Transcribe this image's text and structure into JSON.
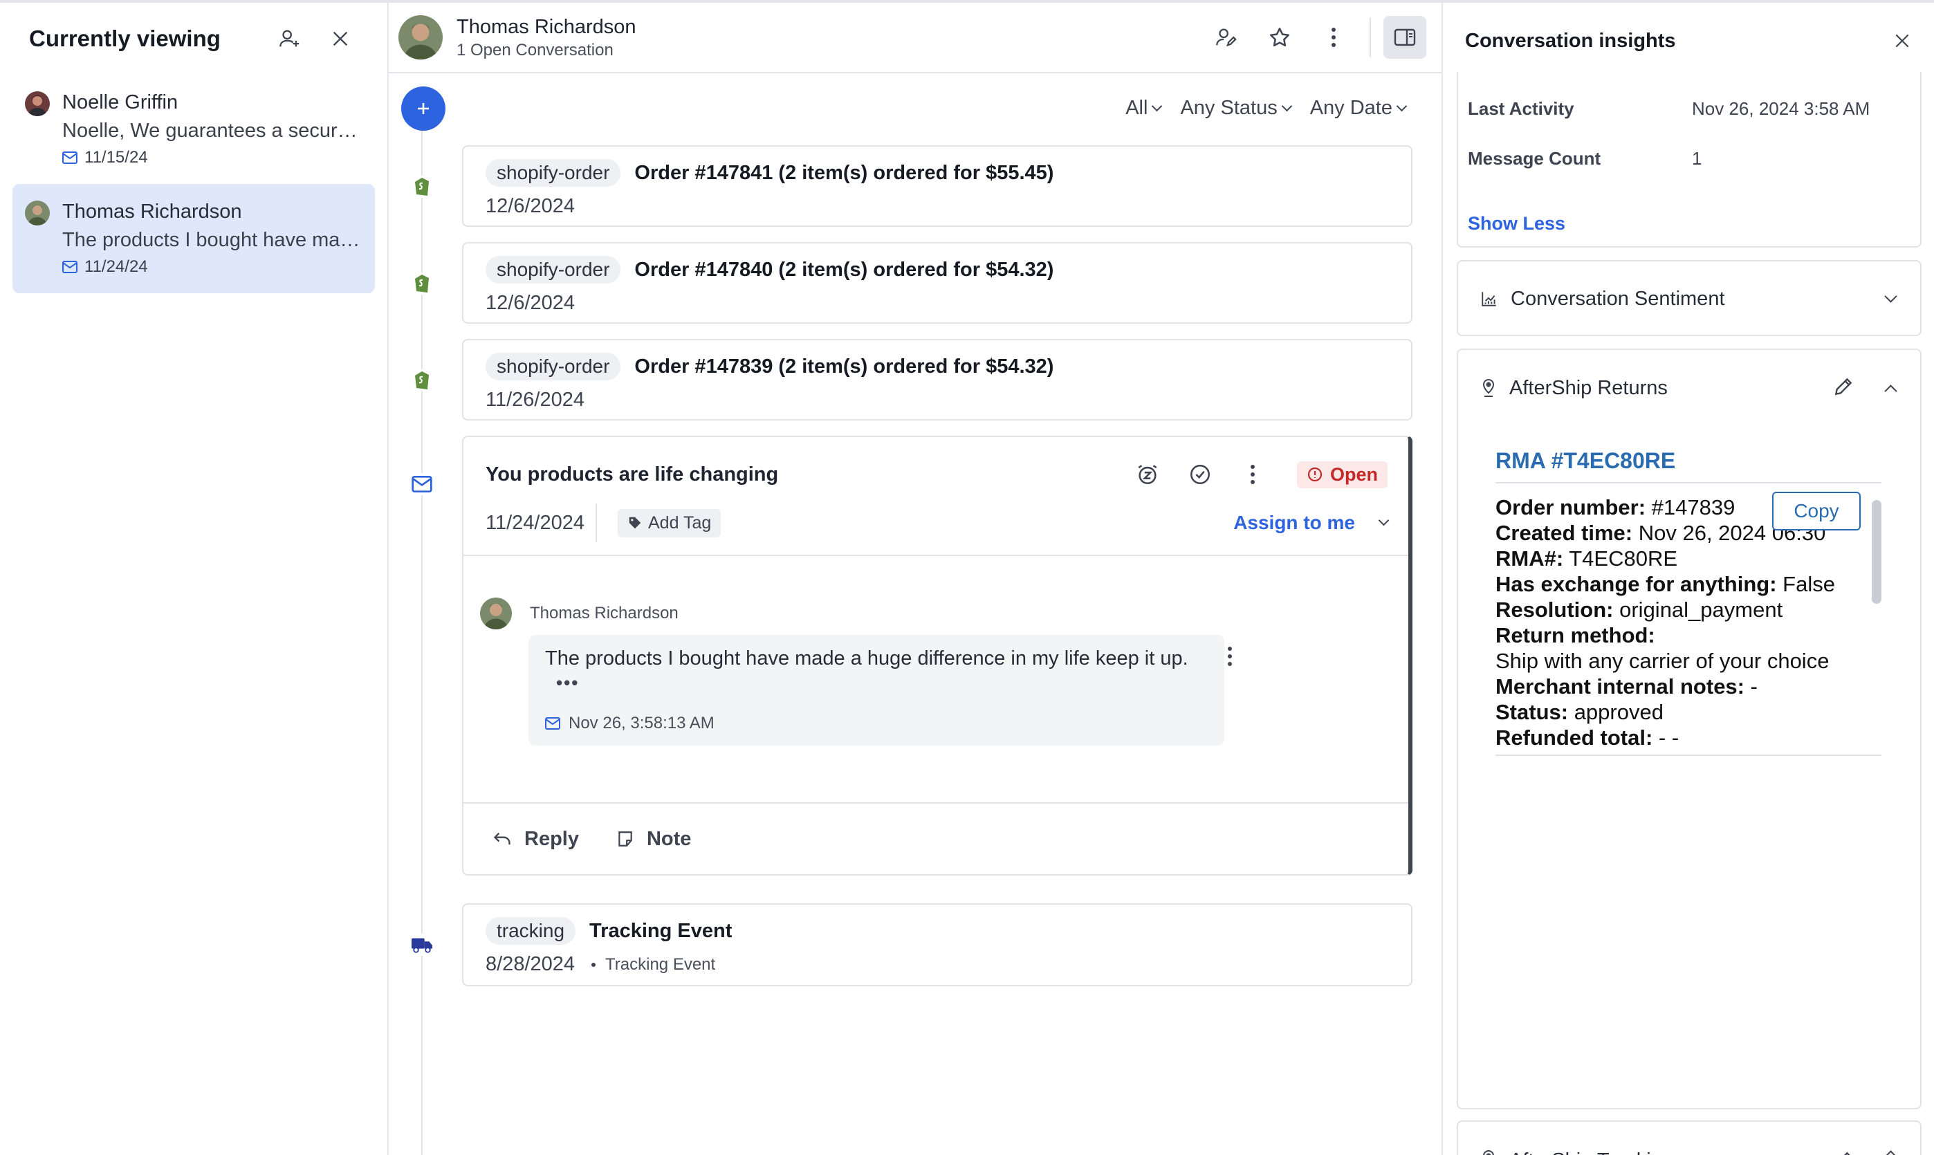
{
  "left_panel": {
    "title": "Currently viewing",
    "conversations": [
      {
        "name": "Noelle Griffin",
        "preview": "Noelle, We guarantees a secure payment process and all transactions are encrypted.",
        "date": "11/15/24",
        "active": false
      },
      {
        "name": "Thomas Richardson",
        "preview": "The products I bought have made a huge difference in my life keep it up.",
        "date": "11/24/24",
        "active": true
      }
    ]
  },
  "header": {
    "customer_name": "Thomas Richardson",
    "subtitle": "1 Open Conversation"
  },
  "filters": {
    "channel": "All",
    "status": "Any Status",
    "date": "Any Date"
  },
  "orders": [
    {
      "pill": "shopify-order",
      "title": "Order #147841 (2 item(s) ordered for $55.45)",
      "date": "12/6/2024"
    },
    {
      "pill": "shopify-order",
      "title": "Order #147840 (2 item(s) ordered for $54.32)",
      "date": "12/6/2024"
    },
    {
      "pill": "shopify-order",
      "title": "Order #147839 (2 item(s) ordered for $54.32)",
      "date": "11/26/2024"
    }
  ],
  "conversation": {
    "subject": "You products are life changing",
    "status": "Open",
    "date": "11/24/2024",
    "add_tag": "Add Tag",
    "assign": "Assign to me",
    "message": {
      "author": "Thomas Richardson",
      "text": "The products I bought have made a huge difference in my life keep it up.",
      "expand": "•••",
      "time": "Nov 26, 3:58:13 AM"
    },
    "reply_label": "Reply",
    "note_label": "Note"
  },
  "tracking": {
    "pill": "tracking",
    "title": "Tracking Event",
    "date": "8/28/2024",
    "sub": "Tracking Event"
  },
  "insights": {
    "title": "Conversation insights",
    "last_activity_label": "Last Activity",
    "last_activity_value": "Nov 26, 2024 3:58 AM",
    "message_count_label": "Message Count",
    "message_count_value": "1",
    "show_less": "Show Less",
    "sentiment_title": "Conversation Sentiment",
    "returns_title": "AfterShip Returns",
    "rma_title": "RMA #T4EC80RE",
    "copy_label": "Copy",
    "rma_fields": {
      "order_number_label": "Order number:",
      "order_number": " #147839",
      "created_label": "Created time:",
      "created": " Nov 26, 2024 06:30",
      "rma_label": "RMA#:",
      "rma": " T4EC80RE",
      "exchange_label": "Has exchange for anything:",
      "exchange": " False",
      "resolution_label": "Resolution:",
      "resolution": " original_payment",
      "return_method_label": "Return method:",
      "return_method": "Ship with any carrier of your choice",
      "notes_label": "Merchant internal notes:",
      "notes": " -",
      "status_label": "Status:",
      "status": " approved",
      "refunded_label": "Refunded total:",
      "refunded": " - -"
    },
    "tracking_title": "AfterShip Tracking"
  },
  "colors": {
    "accent": "#2e63e0",
    "active_item": "#dfe8fb",
    "open_badge_bg": "#fde8e8",
    "open_badge_text": "#c62828",
    "shopify_green": "#5e8e3e",
    "rma_link": "#2b6cb0"
  }
}
